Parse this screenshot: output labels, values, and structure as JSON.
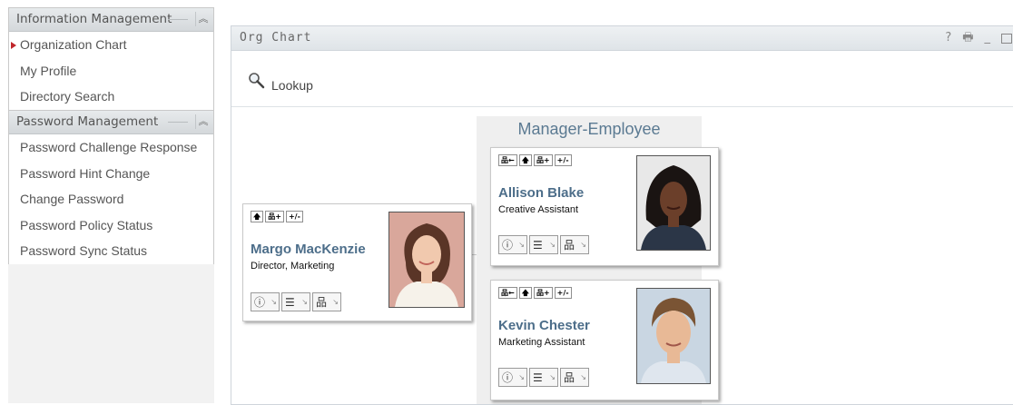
{
  "sidebar": {
    "info_header": "Information Management",
    "info_items": [
      "Organization Chart",
      "My Profile",
      "Directory Search"
    ],
    "pwd_header": "Password Management",
    "pwd_items": [
      "Password Challenge Response",
      "Password Hint Change",
      "Change Password",
      "Password Policy Status",
      "Password Sync Status"
    ]
  },
  "panel": {
    "title": "Org Chart",
    "controls": {
      "help": "?",
      "print": "🖶",
      "minimize": "_"
    },
    "lookup_label": "Lookup"
  },
  "chart": {
    "group_title": "Manager-Employee",
    "actions": {
      "up": "🡅",
      "expand": "品+",
      "toggle": "+/-",
      "back": "品←"
    },
    "tools": {
      "info": "ⓘ",
      "email": "☰",
      "org": "品"
    },
    "manager": {
      "name": "Margo MacKenzie",
      "title": "Director, Marketing"
    },
    "employees": [
      {
        "name": "Allison Blake",
        "title": "Creative Assistant"
      },
      {
        "name": "Kevin Chester",
        "title": "Marketing Assistant"
      }
    ]
  },
  "colors": {
    "accent_name": "#4d6e8a",
    "active_arrow": "#c0262b",
    "header_bg": "#dfe4e8"
  },
  "icons": [
    "collapse-icon",
    "help-icon",
    "print-icon",
    "minimize-icon",
    "maximize-icon",
    "magnifier-icon",
    "info-icon",
    "email-icon",
    "org-icon"
  ]
}
